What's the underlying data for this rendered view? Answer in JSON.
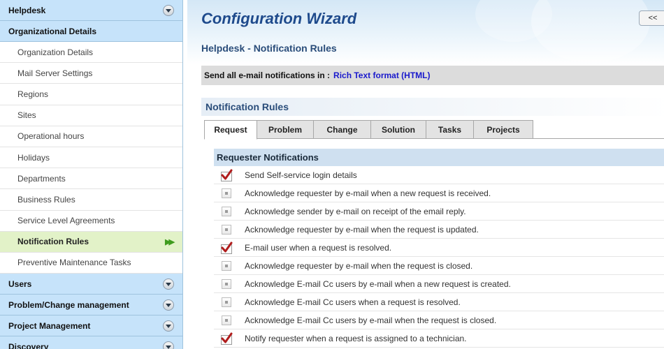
{
  "sidebar": {
    "sections_top": [
      {
        "label": "Helpdesk"
      }
    ],
    "active_section": "Organizational Details",
    "items": [
      {
        "label": "Organization Details",
        "selected": false
      },
      {
        "label": "Mail Server Settings",
        "selected": false
      },
      {
        "label": "Regions",
        "selected": false
      },
      {
        "label": "Sites",
        "selected": false
      },
      {
        "label": "Operational hours",
        "selected": false
      },
      {
        "label": "Holidays",
        "selected": false
      },
      {
        "label": "Departments",
        "selected": false
      },
      {
        "label": "Business Rules",
        "selected": false
      },
      {
        "label": "Service Level Agreements",
        "selected": false
      },
      {
        "label": "Notification Rules",
        "selected": true
      },
      {
        "label": "Preventive Maintenance Tasks",
        "selected": false
      }
    ],
    "sections_bottom": [
      {
        "label": "Users"
      },
      {
        "label": "Problem/Change management"
      },
      {
        "label": "Project Management"
      },
      {
        "label": "Discovery"
      }
    ]
  },
  "header": {
    "title": "Configuration Wizard",
    "back_label": "<<",
    "subtitle": "Helpdesk - Notification Rules"
  },
  "format_bar": {
    "prefix": "Send all e-mail notifications in :",
    "link": "Rich Text format (HTML)"
  },
  "rules": {
    "title": "Notification Rules",
    "tabs": [
      {
        "label": "Request",
        "active": true
      },
      {
        "label": "Problem",
        "active": false
      },
      {
        "label": "Change",
        "active": false
      },
      {
        "label": "Solution",
        "active": false
      },
      {
        "label": "Tasks",
        "active": false
      },
      {
        "label": "Projects",
        "active": false
      }
    ]
  },
  "requester_notifications": {
    "title": "Requester Notifications",
    "items": [
      {
        "label": "Send Self-service login details",
        "checked": true
      },
      {
        "label": "Acknowledge requester by e-mail when a new request is received.",
        "checked": false
      },
      {
        "label": "Acknowledge sender by e-mail on receipt of the email reply.",
        "checked": false
      },
      {
        "label": "Acknowledge requester by e-mail when the request is updated.",
        "checked": false
      },
      {
        "label": "E-mail user when a request is resolved.",
        "checked": true
      },
      {
        "label": "Acknowledge requester by e-mail when the request is closed.",
        "checked": false
      },
      {
        "label": "Acknowledge E-mail Cc users by e-mail when a new request is created.",
        "checked": false
      },
      {
        "label": "Acknowledge E-mail Cc users when a request is resolved.",
        "checked": false
      },
      {
        "label": "Acknowledge E-mail Cc users by e-mail when the request is closed.",
        "checked": false
      },
      {
        "label": "Notify requester when a request is assigned to a technician.",
        "checked": true
      }
    ]
  },
  "colors": {
    "accent": "#1e4a8c",
    "link": "#1a1acc",
    "selected_item_bg": "#e2f2c8",
    "check": "#b01c1c"
  }
}
